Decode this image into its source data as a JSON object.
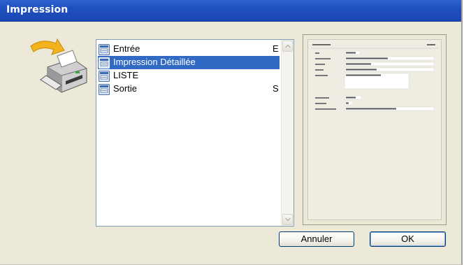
{
  "window": {
    "title": "Impression"
  },
  "report_list": {
    "items": [
      {
        "label": "Entrée",
        "shortcut": "E",
        "selected": false,
        "icon": "report-icon"
      },
      {
        "label": "Impression Détaillée",
        "shortcut": "",
        "selected": true,
        "icon": "report-icon"
      },
      {
        "label": "LISTE",
        "shortcut": "",
        "selected": false,
        "icon": "report-icon"
      },
      {
        "label": "Sortie",
        "shortcut": "S",
        "selected": false,
        "icon": "report-icon"
      }
    ]
  },
  "icons": {
    "main": "printer-icon",
    "scroll_up": "chevron-up-icon",
    "scroll_down": "chevron-down-icon"
  },
  "buttons": {
    "cancel_label": "Annuler",
    "ok_label": "OK"
  },
  "colors": {
    "titlebar": "#1f4fbf",
    "selection": "#316ac5",
    "dialog_bg": "#ece9d8"
  }
}
